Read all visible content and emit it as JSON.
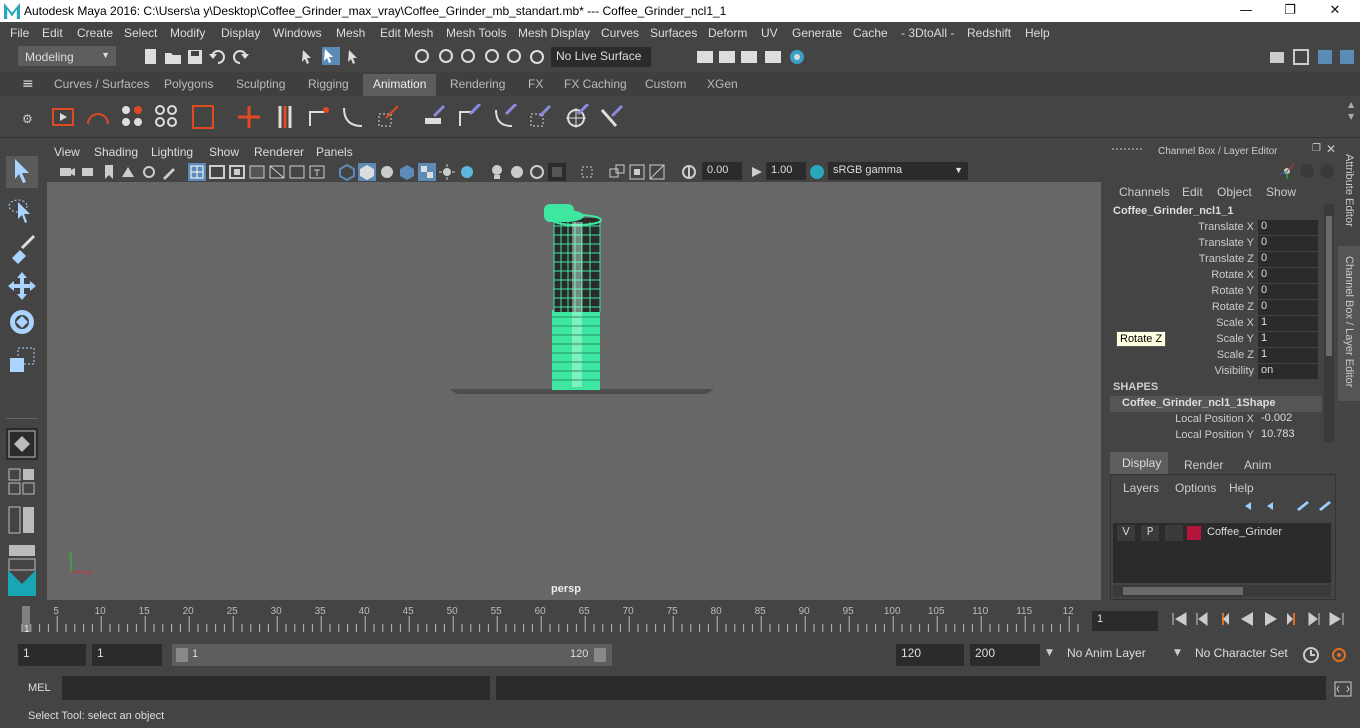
{
  "window": {
    "title": "Autodesk Maya 2016: C:\\Users\\a y\\Desktop\\Coffee_Grinder_max_vray\\Coffee_Grinder_mb_standart.mb*   ---   Coffee_Grinder_ncl1_1",
    "minimize": "—",
    "maximize": "❐",
    "close": "✕"
  },
  "menu": [
    "File",
    "Edit",
    "Create",
    "Select",
    "Modify",
    "Display",
    "Windows",
    "Mesh",
    "Edit Mesh",
    "Mesh Tools",
    "Mesh Display",
    "Curves",
    "Surfaces",
    "Deform",
    "UV",
    "Generate",
    "Cache",
    "- 3DtoAll -",
    "Redshift",
    "Help"
  ],
  "status_line": {
    "mode": "Modeling",
    "live_surface": "No Live Surface"
  },
  "shelf_tabs": [
    "Curves / Surfaces",
    "Polygons",
    "Sculpting",
    "Rigging",
    "Animation",
    "Rendering",
    "FX",
    "FX Caching",
    "Custom",
    "XGen"
  ],
  "active_shelf_tab": "Animation",
  "panel_menu": [
    "View",
    "Shading",
    "Lighting",
    "Show",
    "Renderer",
    "Panels"
  ],
  "panel_toolbar": {
    "exposure": "0.00",
    "gamma": "1.00",
    "color_space": "sRGB gamma"
  },
  "viewport": {
    "camera_label": "persp",
    "axis_x": "x",
    "axis_y": "y",
    "object_color": "#3fe6a0"
  },
  "channel_box": {
    "header": "Channel Box / Layer Editor",
    "menu": [
      "Channels",
      "Edit",
      "Object",
      "Show"
    ],
    "object_name": "Coffee_Grinder_ncl1_1",
    "attributes": [
      {
        "label": "Translate X",
        "value": "0"
      },
      {
        "label": "Translate Y",
        "value": "0"
      },
      {
        "label": "Translate Z",
        "value": "0"
      },
      {
        "label": "Rotate X",
        "value": "0"
      },
      {
        "label": "Rotate Y",
        "value": "0"
      },
      {
        "label": "Rotate Z",
        "value": "0"
      },
      {
        "label": "Scale X",
        "value": "1"
      },
      {
        "label": "Scale Y",
        "value": "1"
      },
      {
        "label": "Scale Z",
        "value": "1"
      },
      {
        "label": "Visibility",
        "value": "on"
      }
    ],
    "shapes_header": "SHAPES",
    "shape_name": "Coffee_Grinder_ncl1_1Shape",
    "shape_attributes": [
      {
        "label": "Local Position X",
        "value": "-0.002"
      },
      {
        "label": "Local Position Y",
        "value": "10.783"
      }
    ],
    "tooltip": "Rotate Z"
  },
  "side_tabs": [
    "Attribute Editor",
    "Channel Box / Layer Editor"
  ],
  "layer_editor": {
    "tabs": [
      "Display",
      "Render",
      "Anim"
    ],
    "active_tab": "Display",
    "menu": [
      "Layers",
      "Options",
      "Help"
    ],
    "layer": {
      "v": "V",
      "p": "P",
      "name": "Coffee_Grinder",
      "color": "#b5153a"
    }
  },
  "timeline": {
    "ticks": [
      "5",
      "10",
      "15",
      "20",
      "25",
      "30",
      "35",
      "40",
      "45",
      "50",
      "55",
      "60",
      "65",
      "70",
      "75",
      "80",
      "85",
      "90",
      "95",
      "100",
      "105",
      "110",
      "115",
      "12"
    ],
    "first": "1",
    "current_frame": "1"
  },
  "range": {
    "start": "1",
    "playback_start": "1",
    "slider_start": "1",
    "slider_end": "120",
    "playback_end": "120",
    "end": "200",
    "anim_layer": "No Anim Layer",
    "character_set": "No Character Set"
  },
  "command_line": {
    "label": "MEL"
  },
  "help_line": "Select Tool: select an object"
}
